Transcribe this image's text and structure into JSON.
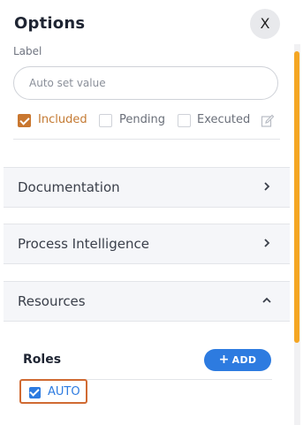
{
  "header": {
    "title": "Options",
    "close_label": "X"
  },
  "label_field": {
    "label": "Label",
    "placeholder": "Auto set value",
    "value": ""
  },
  "statuses": [
    {
      "label": "Included",
      "checked": true
    },
    {
      "label": "Pending",
      "checked": false
    },
    {
      "label": "Executed",
      "checked": false
    }
  ],
  "sections": [
    {
      "label": "Documentation",
      "state": "collapsed"
    },
    {
      "label": "Process Intelligence",
      "state": "collapsed"
    },
    {
      "label": "Resources",
      "state": "expanded"
    }
  ],
  "roles": {
    "title": "Roles",
    "add_label": "ADD",
    "items": [
      {
        "label": "AUTO",
        "checked": true
      }
    ]
  },
  "colors": {
    "accent_orange": "#c9772f",
    "accent_blue": "#2d7be0",
    "scroll_thumb": "#f4a623"
  },
  "icons": {
    "edit": "edit-icon",
    "close": "close-icon",
    "chevron_right": "chevron-right-icon",
    "chevron_up": "chevron-up-icon",
    "plus": "plus-icon"
  }
}
